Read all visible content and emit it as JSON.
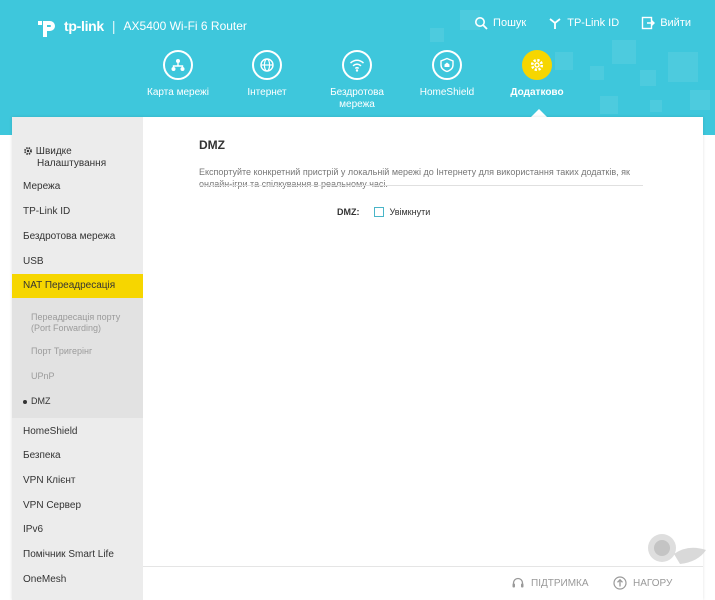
{
  "header": {
    "brand": "tp-link",
    "separator": "|",
    "model": "AX5400 Wi-Fi 6 Router",
    "links": [
      {
        "label": "Пошук",
        "icon": "search-icon"
      },
      {
        "label": "TP-Link ID",
        "icon": "tplink-id-icon"
      },
      {
        "label": "Вийти",
        "icon": "logout-icon"
      }
    ]
  },
  "nav": {
    "tabs": [
      {
        "label": "Карта мережі",
        "icon": "network-map-icon"
      },
      {
        "label": "Інтернет",
        "icon": "globe-icon"
      },
      {
        "label_line1": "Бездротова",
        "label_line2": "мережа",
        "icon": "wifi-icon"
      },
      {
        "label": "HomeShield",
        "icon": "homeshield-icon"
      },
      {
        "label": "Додатково",
        "icon": "gear-icon",
        "active": true
      }
    ]
  },
  "sidebar": {
    "quick_setup_line1": "Швидке",
    "quick_setup_line2": "Налаштування",
    "items": [
      "Мережа",
      "TP-Link ID",
      "Бездротова мережа",
      "USB",
      "NAT Переадресація"
    ],
    "sub_items": {
      "port_forward_line1": "Переадресація порту",
      "port_forward_line2": "(Port Forwarding)",
      "port_trigger": "Порт Тригерінг",
      "upnp": "UPnP",
      "dmz": "DMZ"
    },
    "items_after": [
      "HomeShield",
      "Безпека",
      "VPN Клієнт",
      "VPN Сервер",
      "IPv6",
      "Помічник Smart Life",
      "OneMesh"
    ]
  },
  "content": {
    "title": "DMZ",
    "desc_line1": "Експортуйте конкретний пристрій у локальній мережі до Інтернету для використання таких додатків, як",
    "desc_line2": "онлайн-ігри та спілкування в реальному часі.",
    "dmz_label": "DMZ:",
    "enable_label": "Увімкнути",
    "enabled": false
  },
  "footer": {
    "support": "ПІДТРИМКА",
    "back_to_top": "НАГОРУ"
  },
  "colors": {
    "header_bg": "#3ec7dc",
    "accent_yellow": "#f6d600",
    "sidebar_bg": "#ececec"
  }
}
